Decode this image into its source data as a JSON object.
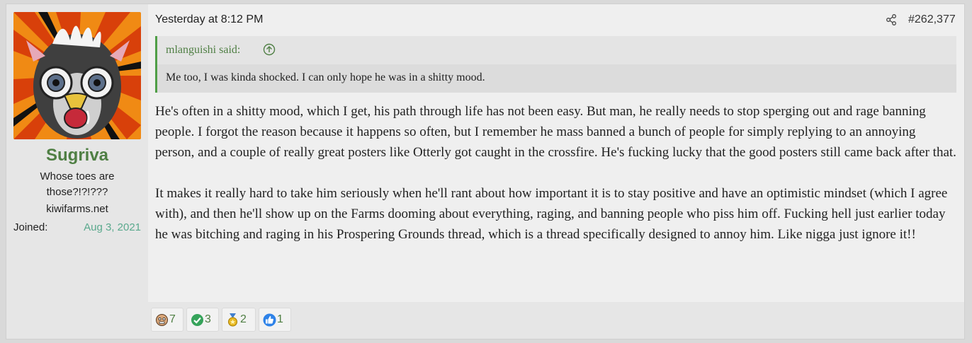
{
  "user": {
    "name": "Sugriva",
    "title": "Whose toes are those?!?!???",
    "site": "kiwifarms.net",
    "joined_label": "Joined:",
    "joined_value": "Aug 3, 2021"
  },
  "post": {
    "timestamp": "Yesterday at 8:12 PM",
    "number": "#262,377",
    "quote": {
      "author": "mlanguishi said:",
      "text": "Me too, I was kinda shocked. I can only hope he was in a shitty mood."
    },
    "paragraphs": [
      "He's often in a shitty mood, which I get, his path through life has not been easy. But man, he really needs to stop sperging out and rage banning people. I forgot the reason because it happens so often, but I remember he mass banned a bunch of people for simply replying to an annoying person, and a couple of really great posters like Otterly got caught in the crossfire. He's fucking lucky that the good posters still came back after that.",
      "It makes it really hard to take him seriously when he'll rant about how important it is to stay positive and have an optimistic mindset (which I agree with), and then he'll show up on the Farms dooming about everything, raging, and banning people who piss him off. Fucking hell just earlier today he was bitching and raging in his Prospering Grounds thread, which is a thread specifically designed to annoy him. Like nigga just ignore it!!"
    ]
  },
  "reactions": [
    {
      "icon": "face-icon",
      "count": "7"
    },
    {
      "icon": "checkmark-icon",
      "count": "3"
    },
    {
      "icon": "medal-icon",
      "count": "2"
    },
    {
      "icon": "thumbs-up-icon",
      "count": "1"
    }
  ],
  "colors": {
    "accent_green": "#4f7f44",
    "joined_teal": "#5aa98d",
    "quote_border": "#4f9e46"
  }
}
